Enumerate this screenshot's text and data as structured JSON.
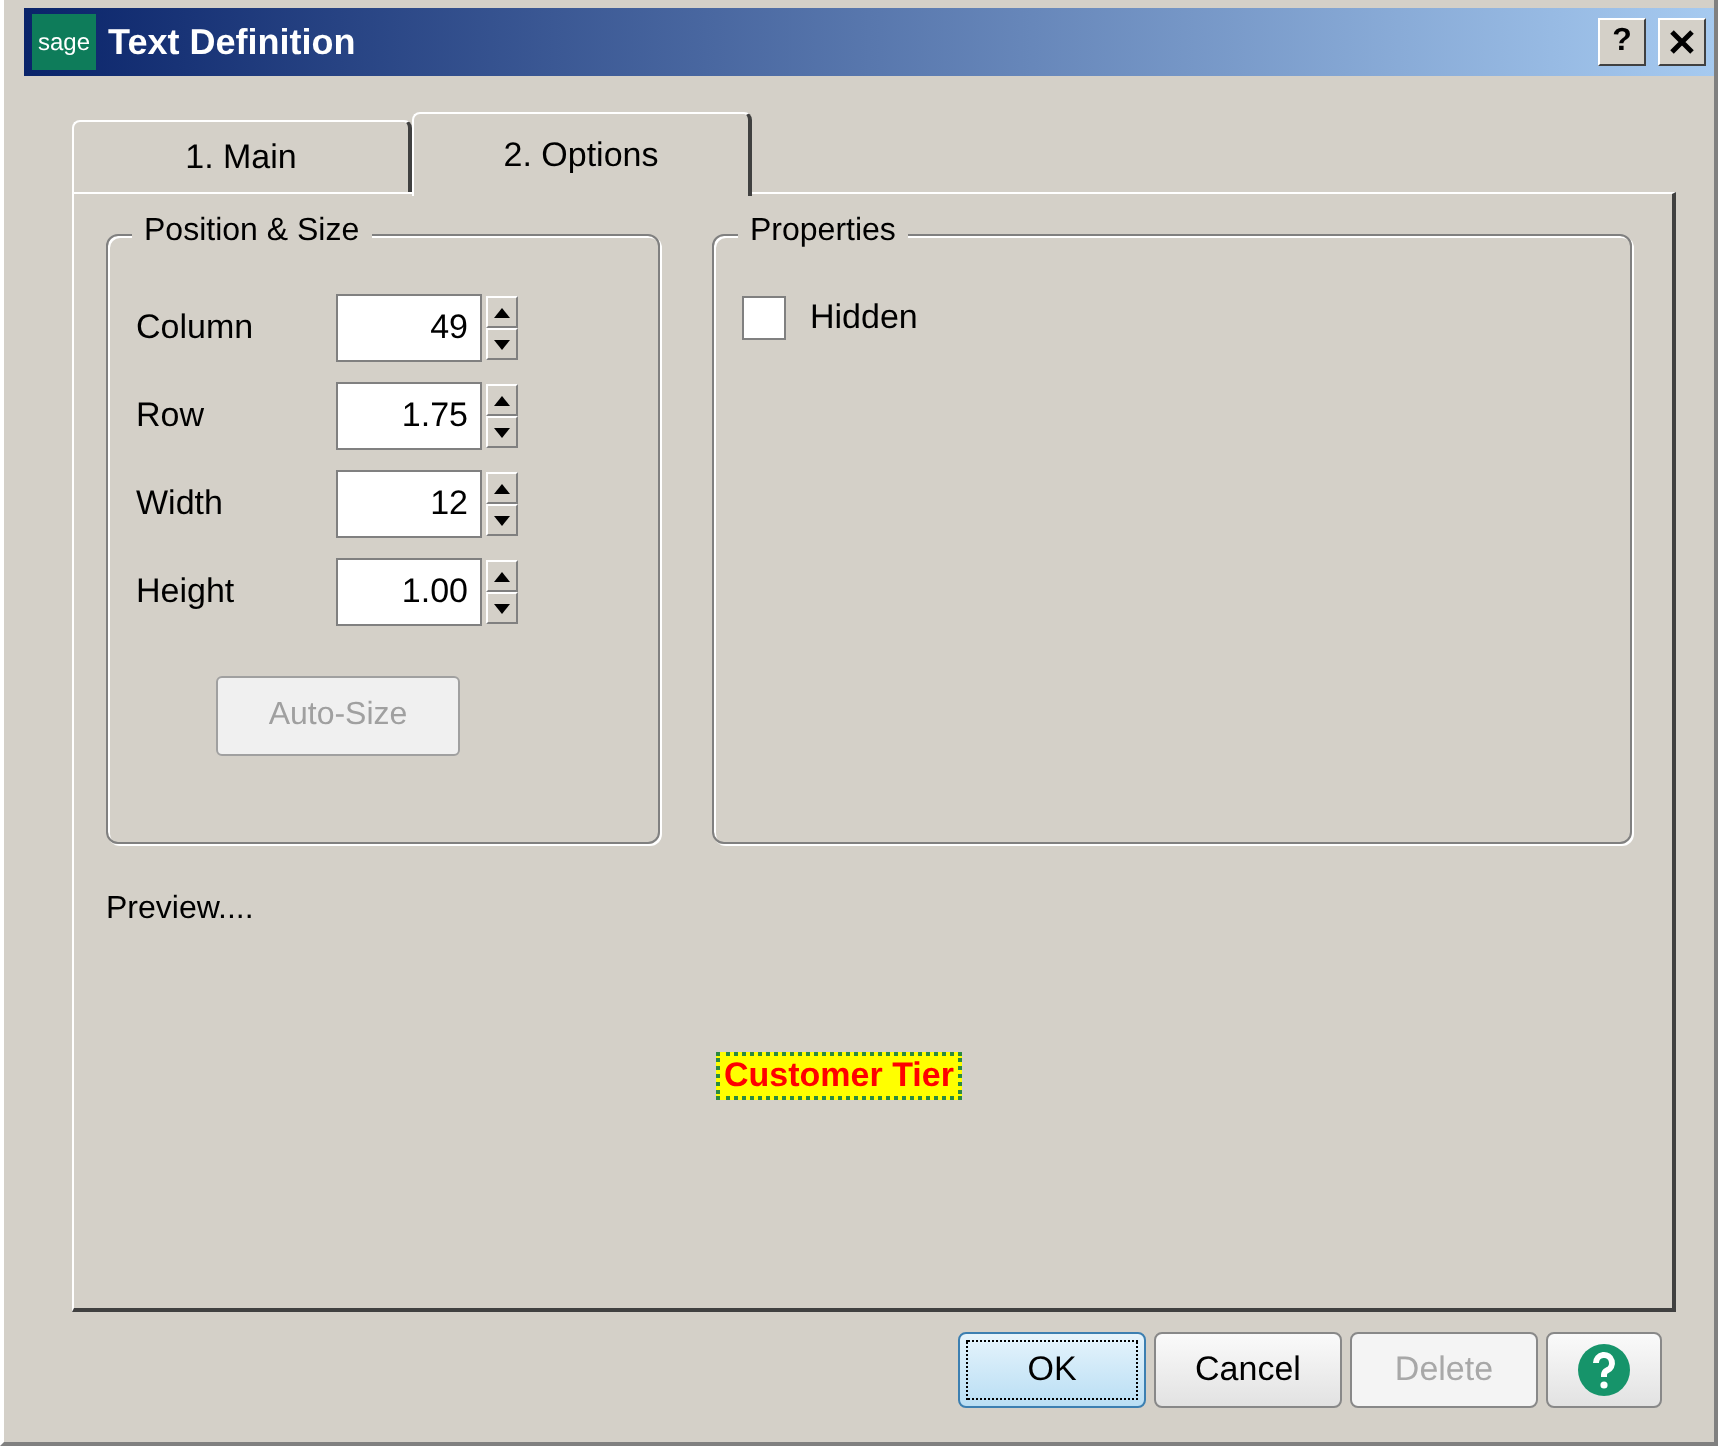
{
  "window": {
    "logo": "sage",
    "title": "Text Definition",
    "help_button": "?"
  },
  "tabs": [
    {
      "label": "1. Main",
      "selected": false
    },
    {
      "label": "2. Options",
      "selected": true
    }
  ],
  "position_size": {
    "title": "Position & Size",
    "fields": [
      {
        "label": "Column",
        "value": "49"
      },
      {
        "label": "Row",
        "value": "1.75"
      },
      {
        "label": "Width",
        "value": "12"
      },
      {
        "label": "Height",
        "value": "1.00"
      }
    ],
    "auto_size_button": {
      "label": "Auto-Size",
      "disabled": true
    }
  },
  "properties": {
    "title": "Properties",
    "hidden": {
      "label": "Hidden",
      "checked": false
    }
  },
  "preview": {
    "label": "Preview....",
    "sample": "Customer Tier"
  },
  "buttons": [
    {
      "label": "OK",
      "disabled": false,
      "default": true
    },
    {
      "label": "Cancel",
      "disabled": false,
      "default": false
    },
    {
      "label": "Delete",
      "disabled": true,
      "default": false
    }
  ]
}
